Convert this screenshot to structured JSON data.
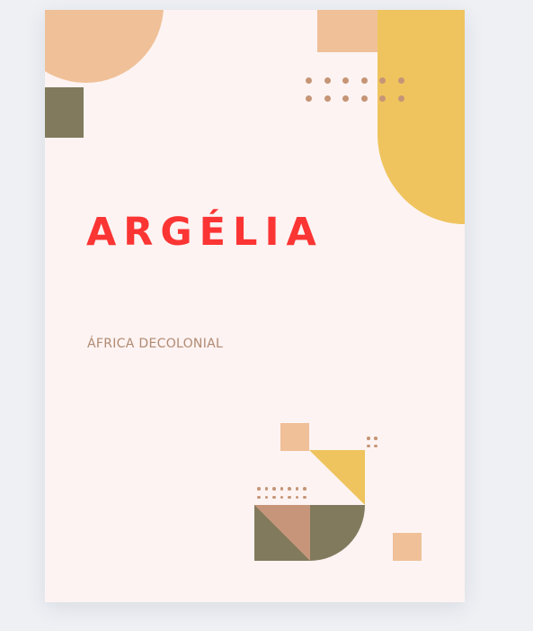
{
  "cover": {
    "title": "ARGÉLIA",
    "subtitle": "ÁFRICA DECOLONIAL"
  },
  "colors": {
    "background": "#eef0f4",
    "paper": "#fdf3f2",
    "title": "#fb3534",
    "subtitle": "#b08a72",
    "peach": "#f0c098",
    "mustard": "#efc45e",
    "olive": "#817a5d",
    "terracotta": "#c6957a",
    "dot": "#c59576"
  }
}
